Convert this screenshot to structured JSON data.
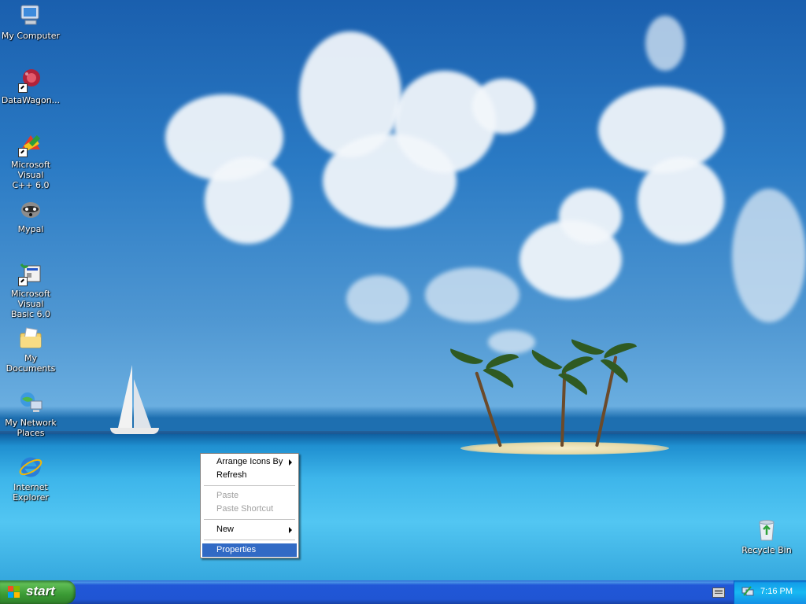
{
  "desktop": {
    "icons": [
      {
        "label_line1": "My Computer",
        "label_line2": "",
        "icon": "computer-icon"
      },
      {
        "label_line1": "DataWagon...",
        "label_line2": "",
        "icon": "datawagon-icon"
      },
      {
        "label_line1": "Microsoft Visual",
        "label_line2": "C++ 6.0",
        "icon": "visual-cpp-icon"
      },
      {
        "label_line1": "Mypal",
        "label_line2": "",
        "icon": "mypal-raccoon-icon"
      },
      {
        "label_line1": "Microsoft Visual",
        "label_line2": "Basic 6.0",
        "icon": "visual-basic-icon"
      },
      {
        "label_line1": "My Documents",
        "label_line2": "",
        "icon": "documents-folder-icon"
      },
      {
        "label_line1": "My Network",
        "label_line2": "Places",
        "icon": "network-places-icon"
      },
      {
        "label_line1": "Internet",
        "label_line2": "Explorer",
        "icon": "internet-explorer-icon"
      },
      {
        "label_line1": "Recycle Bin",
        "label_line2": "",
        "icon": "recycle-bin-icon"
      }
    ]
  },
  "context_menu": {
    "items": [
      {
        "label": "Arrange Icons By",
        "enabled": true,
        "submenu": true
      },
      {
        "label": "Refresh",
        "enabled": true,
        "submenu": false
      },
      {
        "label": "Paste",
        "enabled": false,
        "submenu": false
      },
      {
        "label": "Paste Shortcut",
        "enabled": false,
        "submenu": false
      },
      {
        "label": "New",
        "enabled": true,
        "submenu": true
      },
      {
        "label": "Properties",
        "enabled": true,
        "submenu": false,
        "selected": true
      }
    ]
  },
  "taskbar": {
    "start_label": "start",
    "clock": "7:16 PM",
    "tray_icons": [
      "keyboard-icon",
      "network-tray-icon"
    ]
  },
  "colors": {
    "taskbar_blue": "#2457d4",
    "start_green": "#3a9a34",
    "menu_highlight": "#316ac5",
    "tray_blue": "#18b9f2"
  }
}
